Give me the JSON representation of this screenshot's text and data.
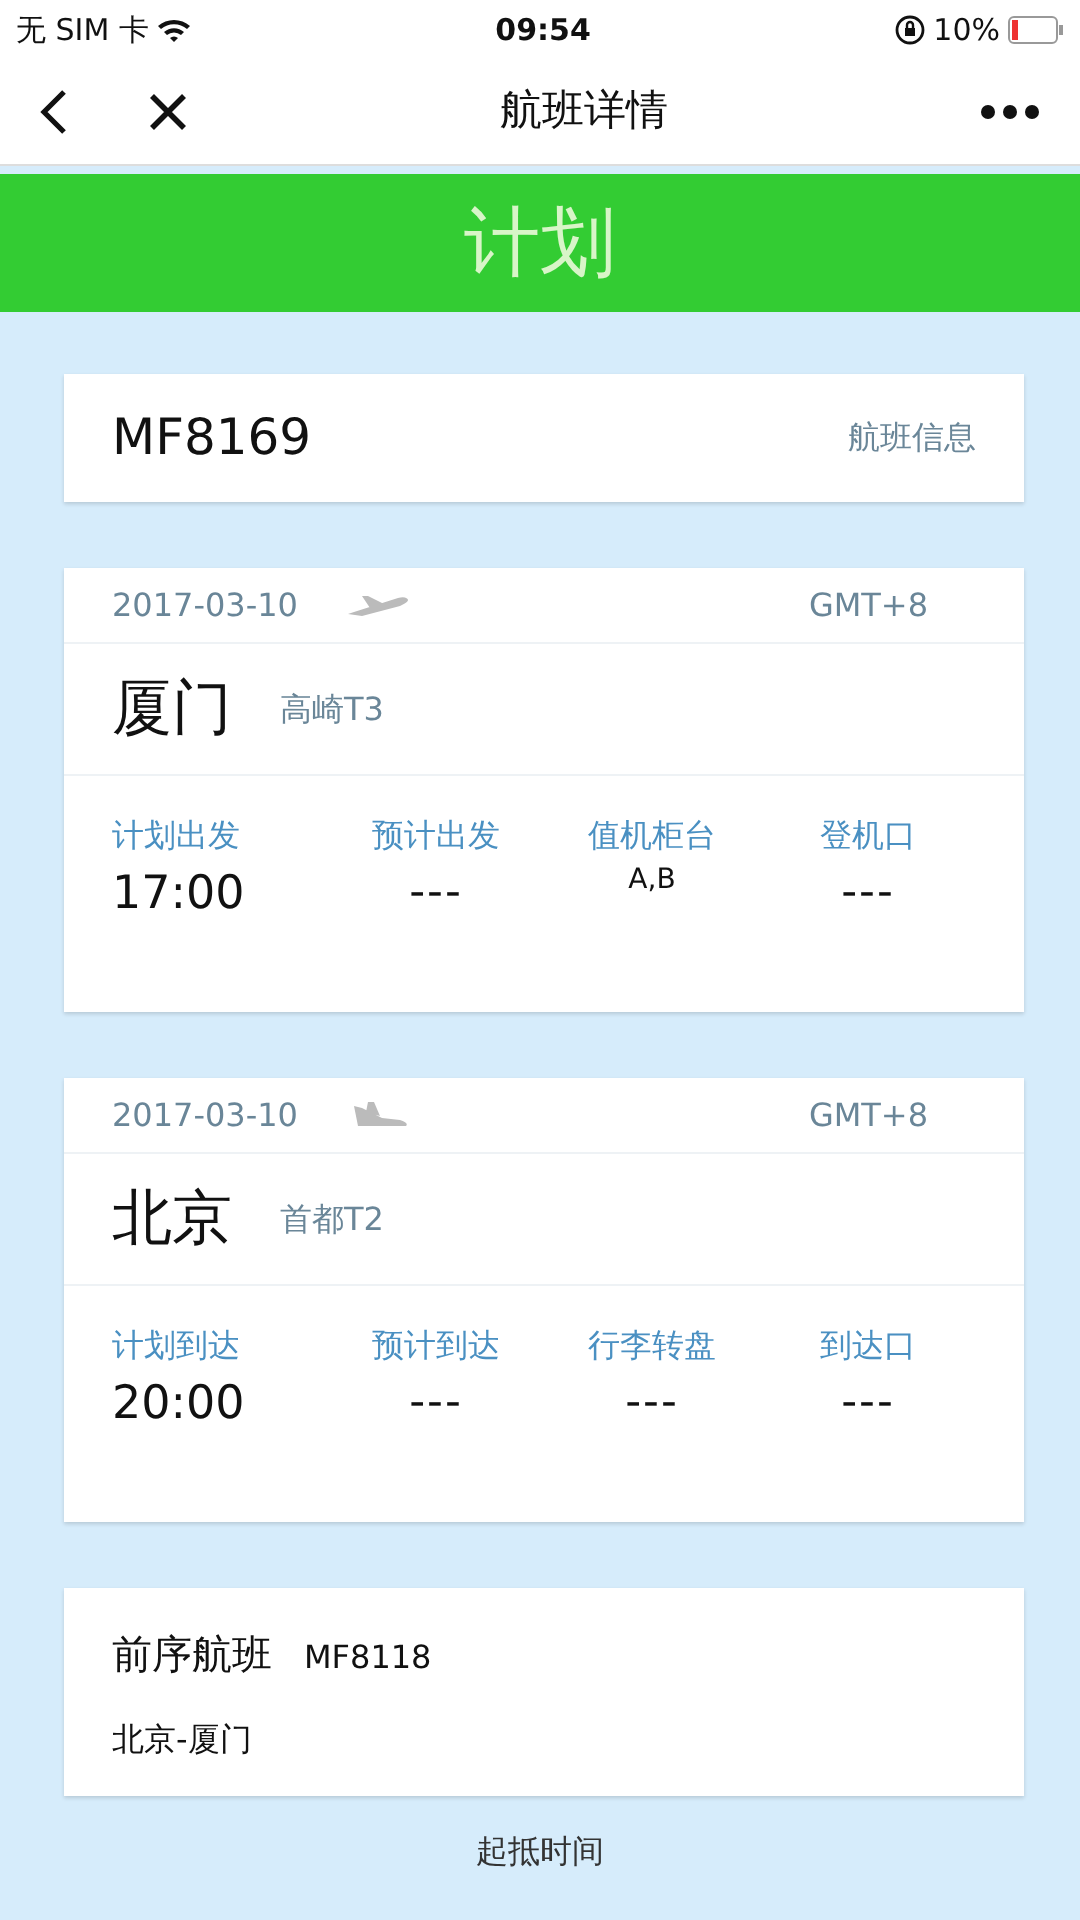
{
  "status_bar": {
    "carrier": "无 SIM 卡",
    "time": "09:54",
    "battery": "10%"
  },
  "nav": {
    "title": "航班详情"
  },
  "banner": {
    "status": "计划"
  },
  "flight": {
    "number": "MF8169",
    "link": "航班信息"
  },
  "segments": [
    {
      "kind": "departure",
      "date": "2017-03-10",
      "timezone": "GMT+8",
      "city": "厦门",
      "terminal": "高崎T3",
      "fields": [
        {
          "label": "计划出发",
          "value": "17:00",
          "kind": "time"
        },
        {
          "label": "预计出发",
          "value": "---",
          "kind": "dash"
        },
        {
          "label": "值机柜台",
          "value": "A,B",
          "kind": "small"
        },
        {
          "label": "登机口",
          "value": "---",
          "kind": "dash"
        }
      ]
    },
    {
      "kind": "arrival",
      "date": "2017-03-10",
      "timezone": "GMT+8",
      "city": "北京",
      "terminal": "首都T2",
      "fields": [
        {
          "label": "计划到达",
          "value": "20:00",
          "kind": "time"
        },
        {
          "label": "预计到达",
          "value": "---",
          "kind": "dash"
        },
        {
          "label": "行李转盘",
          "value": "---",
          "kind": "dash"
        },
        {
          "label": "到达口",
          "value": "---",
          "kind": "dash"
        }
      ]
    }
  ],
  "previous": {
    "label": "前序航班",
    "flight": "MF8118",
    "route": "北京-厦门"
  },
  "footnote": "起抵时间"
}
